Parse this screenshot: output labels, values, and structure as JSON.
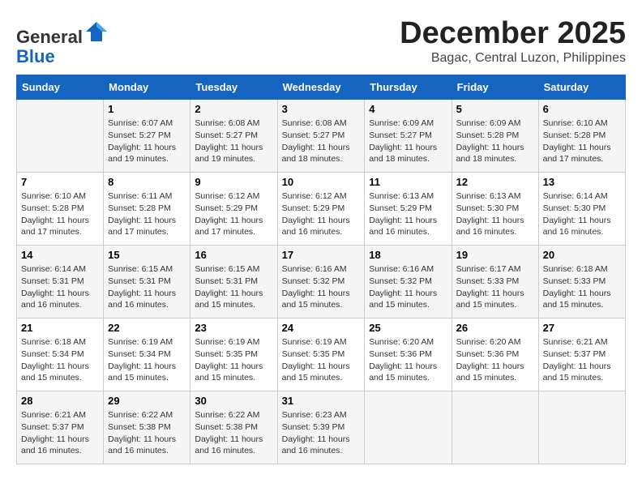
{
  "logo": {
    "general": "General",
    "blue": "Blue"
  },
  "header": {
    "month": "December 2025",
    "location": "Bagac, Central Luzon, Philippines"
  },
  "weekdays": [
    "Sunday",
    "Monday",
    "Tuesday",
    "Wednesday",
    "Thursday",
    "Friday",
    "Saturday"
  ],
  "weeks": [
    [
      {
        "day": "",
        "info": ""
      },
      {
        "day": "1",
        "info": "Sunrise: 6:07 AM\nSunset: 5:27 PM\nDaylight: 11 hours\nand 19 minutes."
      },
      {
        "day": "2",
        "info": "Sunrise: 6:08 AM\nSunset: 5:27 PM\nDaylight: 11 hours\nand 19 minutes."
      },
      {
        "day": "3",
        "info": "Sunrise: 6:08 AM\nSunset: 5:27 PM\nDaylight: 11 hours\nand 18 minutes."
      },
      {
        "day": "4",
        "info": "Sunrise: 6:09 AM\nSunset: 5:27 PM\nDaylight: 11 hours\nand 18 minutes."
      },
      {
        "day": "5",
        "info": "Sunrise: 6:09 AM\nSunset: 5:28 PM\nDaylight: 11 hours\nand 18 minutes."
      },
      {
        "day": "6",
        "info": "Sunrise: 6:10 AM\nSunset: 5:28 PM\nDaylight: 11 hours\nand 17 minutes."
      }
    ],
    [
      {
        "day": "7",
        "info": "Sunrise: 6:10 AM\nSunset: 5:28 PM\nDaylight: 11 hours\nand 17 minutes."
      },
      {
        "day": "8",
        "info": "Sunrise: 6:11 AM\nSunset: 5:28 PM\nDaylight: 11 hours\nand 17 minutes."
      },
      {
        "day": "9",
        "info": "Sunrise: 6:12 AM\nSunset: 5:29 PM\nDaylight: 11 hours\nand 17 minutes."
      },
      {
        "day": "10",
        "info": "Sunrise: 6:12 AM\nSunset: 5:29 PM\nDaylight: 11 hours\nand 16 minutes."
      },
      {
        "day": "11",
        "info": "Sunrise: 6:13 AM\nSunset: 5:29 PM\nDaylight: 11 hours\nand 16 minutes."
      },
      {
        "day": "12",
        "info": "Sunrise: 6:13 AM\nSunset: 5:30 PM\nDaylight: 11 hours\nand 16 minutes."
      },
      {
        "day": "13",
        "info": "Sunrise: 6:14 AM\nSunset: 5:30 PM\nDaylight: 11 hours\nand 16 minutes."
      }
    ],
    [
      {
        "day": "14",
        "info": "Sunrise: 6:14 AM\nSunset: 5:31 PM\nDaylight: 11 hours\nand 16 minutes."
      },
      {
        "day": "15",
        "info": "Sunrise: 6:15 AM\nSunset: 5:31 PM\nDaylight: 11 hours\nand 16 minutes."
      },
      {
        "day": "16",
        "info": "Sunrise: 6:15 AM\nSunset: 5:31 PM\nDaylight: 11 hours\nand 15 minutes."
      },
      {
        "day": "17",
        "info": "Sunrise: 6:16 AM\nSunset: 5:32 PM\nDaylight: 11 hours\nand 15 minutes."
      },
      {
        "day": "18",
        "info": "Sunrise: 6:16 AM\nSunset: 5:32 PM\nDaylight: 11 hours\nand 15 minutes."
      },
      {
        "day": "19",
        "info": "Sunrise: 6:17 AM\nSunset: 5:33 PM\nDaylight: 11 hours\nand 15 minutes."
      },
      {
        "day": "20",
        "info": "Sunrise: 6:18 AM\nSunset: 5:33 PM\nDaylight: 11 hours\nand 15 minutes."
      }
    ],
    [
      {
        "day": "21",
        "info": "Sunrise: 6:18 AM\nSunset: 5:34 PM\nDaylight: 11 hours\nand 15 minutes."
      },
      {
        "day": "22",
        "info": "Sunrise: 6:19 AM\nSunset: 5:34 PM\nDaylight: 11 hours\nand 15 minutes."
      },
      {
        "day": "23",
        "info": "Sunrise: 6:19 AM\nSunset: 5:35 PM\nDaylight: 11 hours\nand 15 minutes."
      },
      {
        "day": "24",
        "info": "Sunrise: 6:19 AM\nSunset: 5:35 PM\nDaylight: 11 hours\nand 15 minutes."
      },
      {
        "day": "25",
        "info": "Sunrise: 6:20 AM\nSunset: 5:36 PM\nDaylight: 11 hours\nand 15 minutes."
      },
      {
        "day": "26",
        "info": "Sunrise: 6:20 AM\nSunset: 5:36 PM\nDaylight: 11 hours\nand 15 minutes."
      },
      {
        "day": "27",
        "info": "Sunrise: 6:21 AM\nSunset: 5:37 PM\nDaylight: 11 hours\nand 15 minutes."
      }
    ],
    [
      {
        "day": "28",
        "info": "Sunrise: 6:21 AM\nSunset: 5:37 PM\nDaylight: 11 hours\nand 16 minutes."
      },
      {
        "day": "29",
        "info": "Sunrise: 6:22 AM\nSunset: 5:38 PM\nDaylight: 11 hours\nand 16 minutes."
      },
      {
        "day": "30",
        "info": "Sunrise: 6:22 AM\nSunset: 5:38 PM\nDaylight: 11 hours\nand 16 minutes."
      },
      {
        "day": "31",
        "info": "Sunrise: 6:23 AM\nSunset: 5:39 PM\nDaylight: 11 hours\nand 16 minutes."
      },
      {
        "day": "",
        "info": ""
      },
      {
        "day": "",
        "info": ""
      },
      {
        "day": "",
        "info": ""
      }
    ]
  ]
}
